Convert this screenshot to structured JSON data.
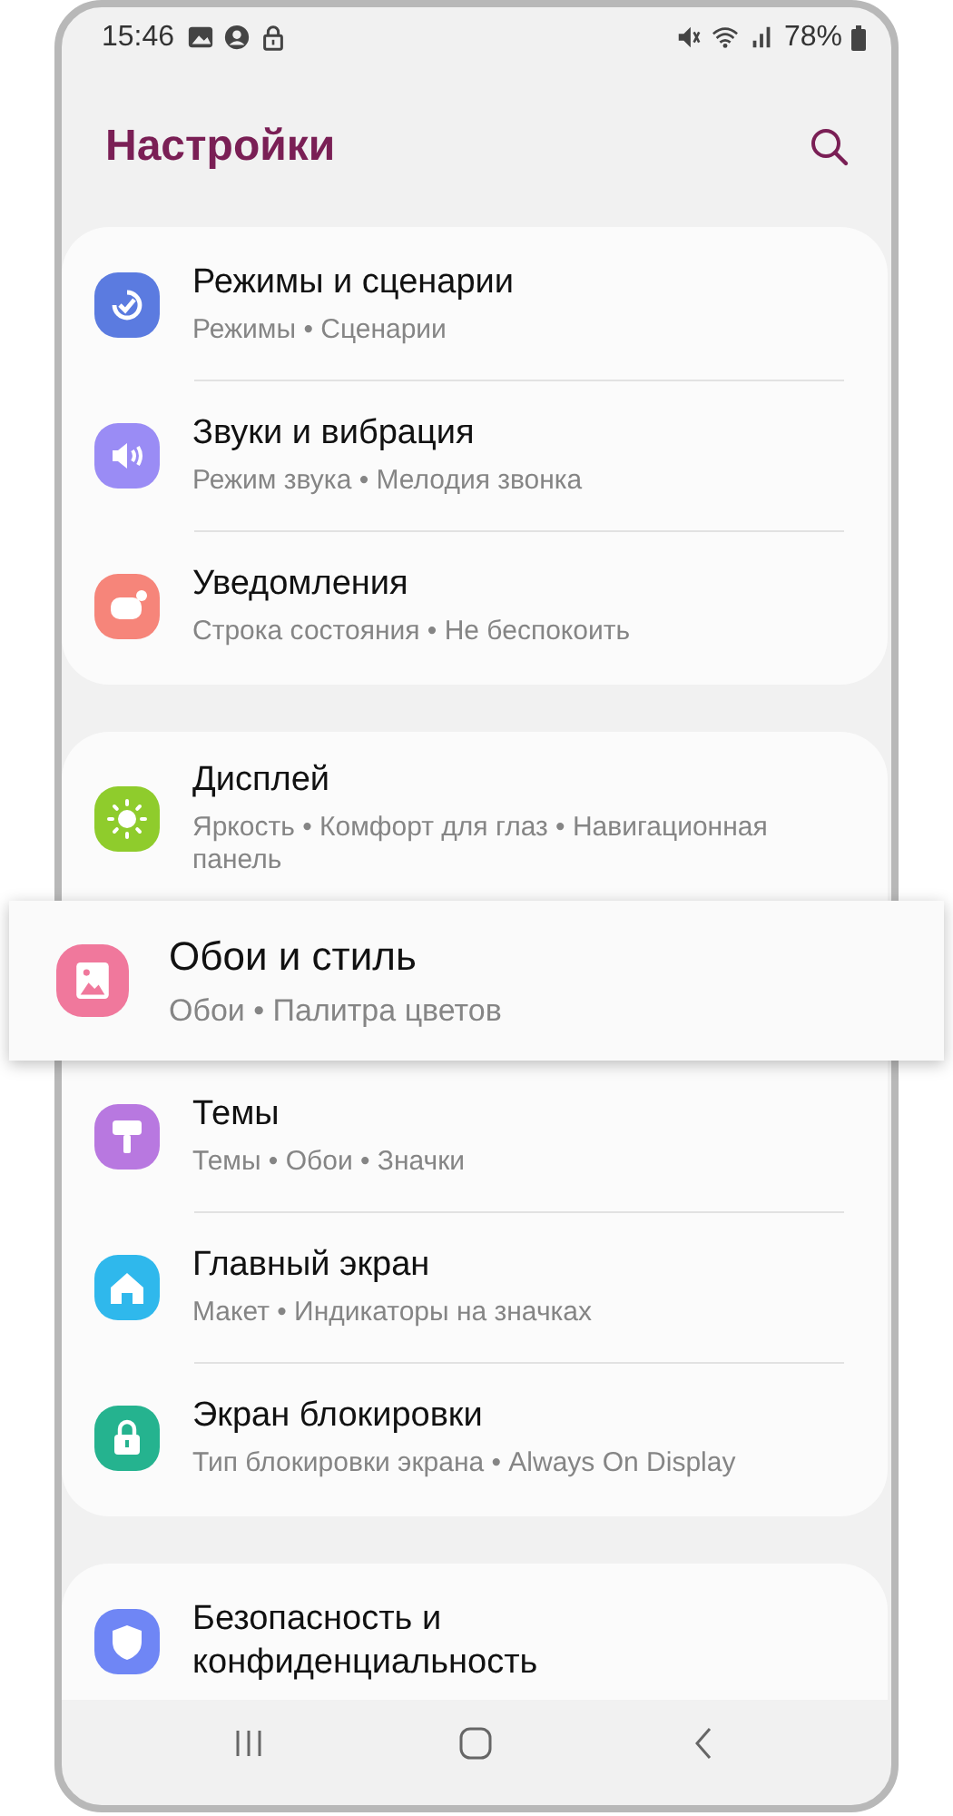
{
  "status_bar": {
    "time": "15:46",
    "battery": "78%"
  },
  "header": {
    "title": "Настройки"
  },
  "groups": [
    {
      "items": [
        {
          "title": "Режимы и сценарии",
          "subtitle": "Режимы • Сценарии",
          "color": "#5b7be0",
          "highlighted": false
        },
        {
          "title": "Звуки и вибрация",
          "subtitle": "Режим звука • Мелодия звонка",
          "color": "#9a8cf5",
          "highlighted": false
        },
        {
          "title": "Уведомления",
          "subtitle": "Строка состояния • Не беспокоить",
          "color": "#f6857a",
          "highlighted": false
        }
      ]
    },
    {
      "items": [
        {
          "title": "Дисплей",
          "subtitle": "Яркость • Комфорт для глаз • Навигационная панель",
          "color": "#8fcc2c",
          "highlighted": false
        },
        {
          "title": "Обои и стиль",
          "subtitle": "Обои • Палитра цветов",
          "color": "#f0789c",
          "highlighted": true
        },
        {
          "title": "Темы",
          "subtitle": "Темы • Обои • Значки",
          "color": "#b878e0",
          "highlighted": false
        },
        {
          "title": "Главный экран",
          "subtitle": "Макет • Индикаторы на значках",
          "color": "#2fb8ec",
          "highlighted": false
        },
        {
          "title": "Экран блокировки",
          "subtitle": "Тип блокировки экрана • Always On Display",
          "color": "#25b38f",
          "highlighted": false
        }
      ]
    },
    {
      "items": [
        {
          "title": "Безопасность и конфиденциальность",
          "color": "#6f86f5",
          "highlighted": false
        }
      ]
    }
  ]
}
